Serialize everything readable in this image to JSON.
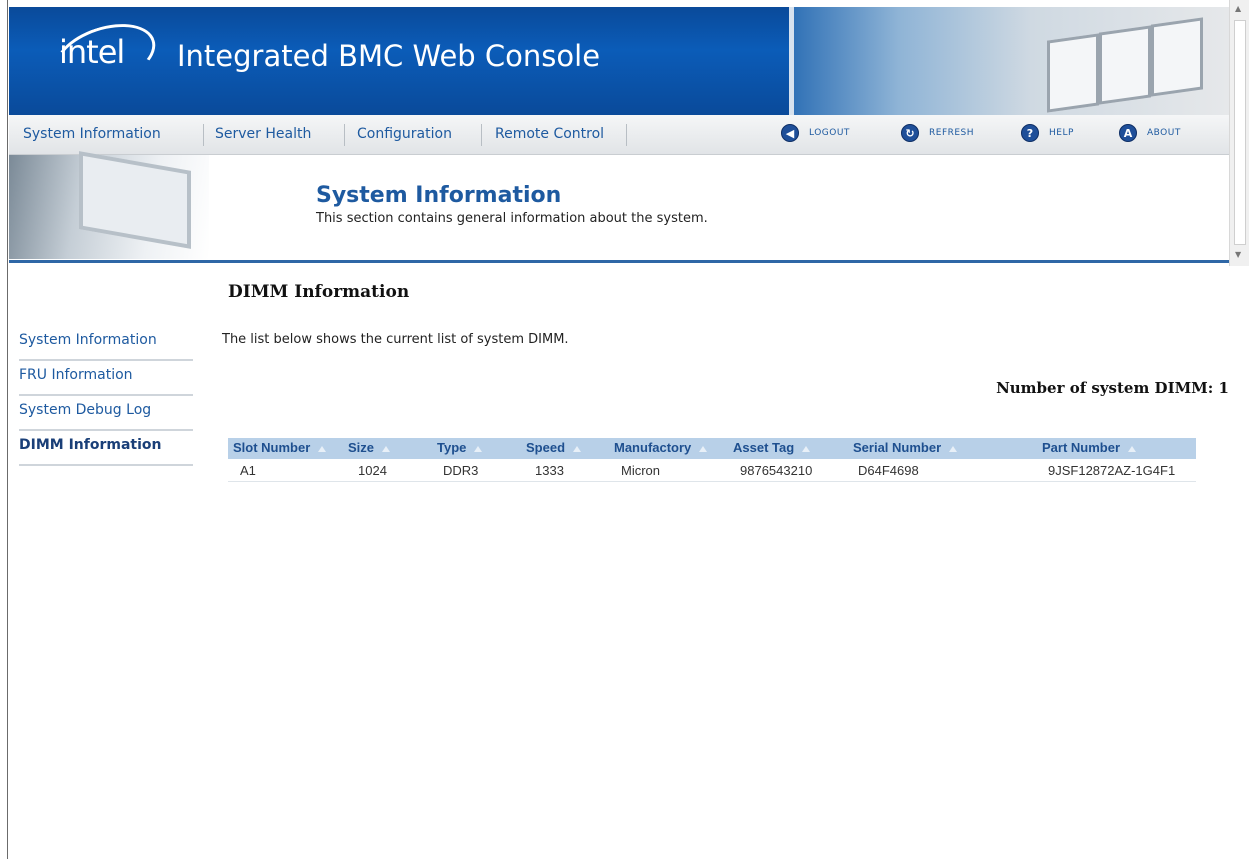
{
  "banner": {
    "logo_text": "intel",
    "title": "Integrated BMC Web Console"
  },
  "nav": {
    "tabs": [
      {
        "label": "System Information"
      },
      {
        "label": "Server Health"
      },
      {
        "label": "Configuration"
      },
      {
        "label": "Remote Control"
      }
    ],
    "actions": [
      {
        "label": "LOGOUT",
        "icon": "logout-icon",
        "glyph": "◀"
      },
      {
        "label": "REFRESH",
        "icon": "refresh-icon",
        "glyph": "↻"
      },
      {
        "label": "HELP",
        "icon": "help-icon",
        "glyph": "?"
      },
      {
        "label": "ABOUT",
        "icon": "about-icon",
        "glyph": "A"
      }
    ]
  },
  "section": {
    "title": "System Information",
    "subtitle": "This section contains general information about the system."
  },
  "sidebar": {
    "items": [
      {
        "label": "System Information",
        "active": false
      },
      {
        "label": "FRU Information",
        "active": false
      },
      {
        "label": "System Debug Log",
        "active": false
      },
      {
        "label": "DIMM Information",
        "active": true
      }
    ]
  },
  "main": {
    "heading": "DIMM Information",
    "description": "The list below shows the current list of system DIMM.",
    "count_label": "Number of system DIMM: 1"
  },
  "table": {
    "columns": [
      "Slot Number",
      "Size",
      "Type",
      "Speed",
      "Manufactory",
      "Asset Tag",
      "Serial Number",
      "Part Number"
    ],
    "rows": [
      [
        "A1",
        "1024",
        "DDR3",
        "1333",
        "Micron",
        "9876543210",
        "D64F4698",
        "9JSF12872AZ-1G4F1"
      ]
    ]
  },
  "colors": {
    "banner_blue": "#0b5cb8",
    "link_blue": "#1e5aa0",
    "table_header": "#b8d0e8",
    "rule_blue": "#2f67a6"
  }
}
